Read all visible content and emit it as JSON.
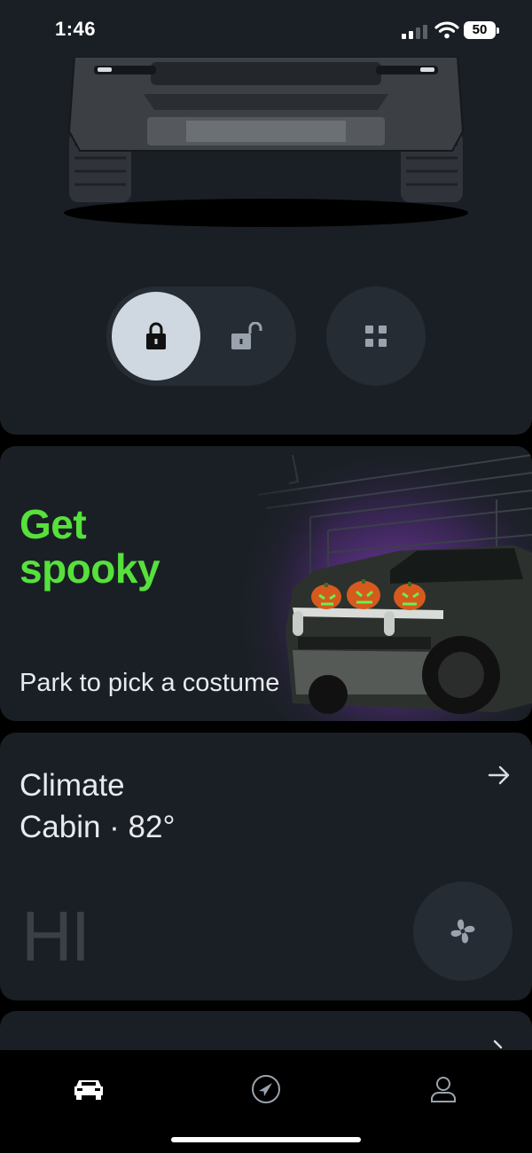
{
  "status_bar": {
    "time": "1:46",
    "battery": "50"
  },
  "vehicle": {
    "lock_icon": "lock-closed-icon",
    "unlock_icon": "lock-open-icon",
    "more_icon": "grid-icon"
  },
  "promo": {
    "title": "Get spooky",
    "subtitle": "Park to pick a costume",
    "title_color": "#56e13b"
  },
  "climate": {
    "title": "Climate",
    "subtitle": "Cabin · 82°",
    "fan_level": "HI"
  },
  "tabs": [
    {
      "icon": "vehicle-icon",
      "active": true
    },
    {
      "icon": "navigation-icon",
      "active": false
    },
    {
      "icon": "profile-icon",
      "active": false
    }
  ]
}
